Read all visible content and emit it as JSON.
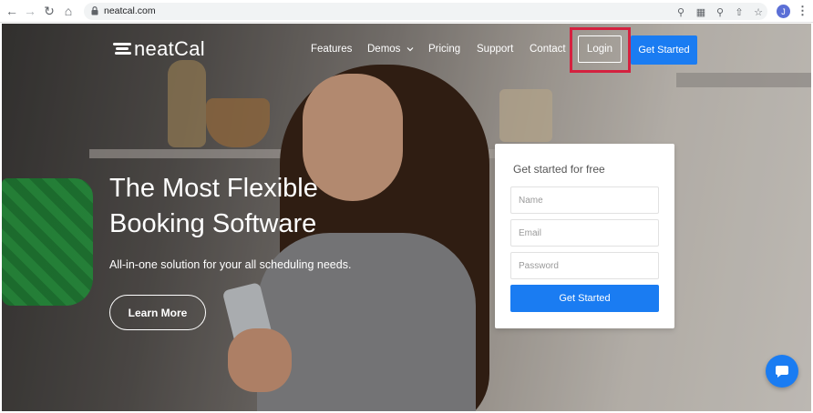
{
  "browser": {
    "url": "neatcal.com",
    "profile_initial": "J"
  },
  "site": {
    "logo_text": "neatCal",
    "nav": {
      "features": "Features",
      "demos": "Demos",
      "pricing": "Pricing",
      "support": "Support",
      "contact": "Contact",
      "login": "Login",
      "get_started": "Get Started"
    },
    "hero": {
      "headline_line1": "The Most Flexible",
      "headline_line2": "Booking Software",
      "subline": "All-in-one solution for your all scheduling needs.",
      "learn_more": "Learn More"
    },
    "signup": {
      "title": "Get started for free",
      "name_placeholder": "Name",
      "email_placeholder": "Email",
      "password_placeholder": "Password",
      "submit": "Get Started"
    }
  },
  "colors": {
    "accent": "#1a7cf2",
    "highlight": "#d4213f"
  }
}
